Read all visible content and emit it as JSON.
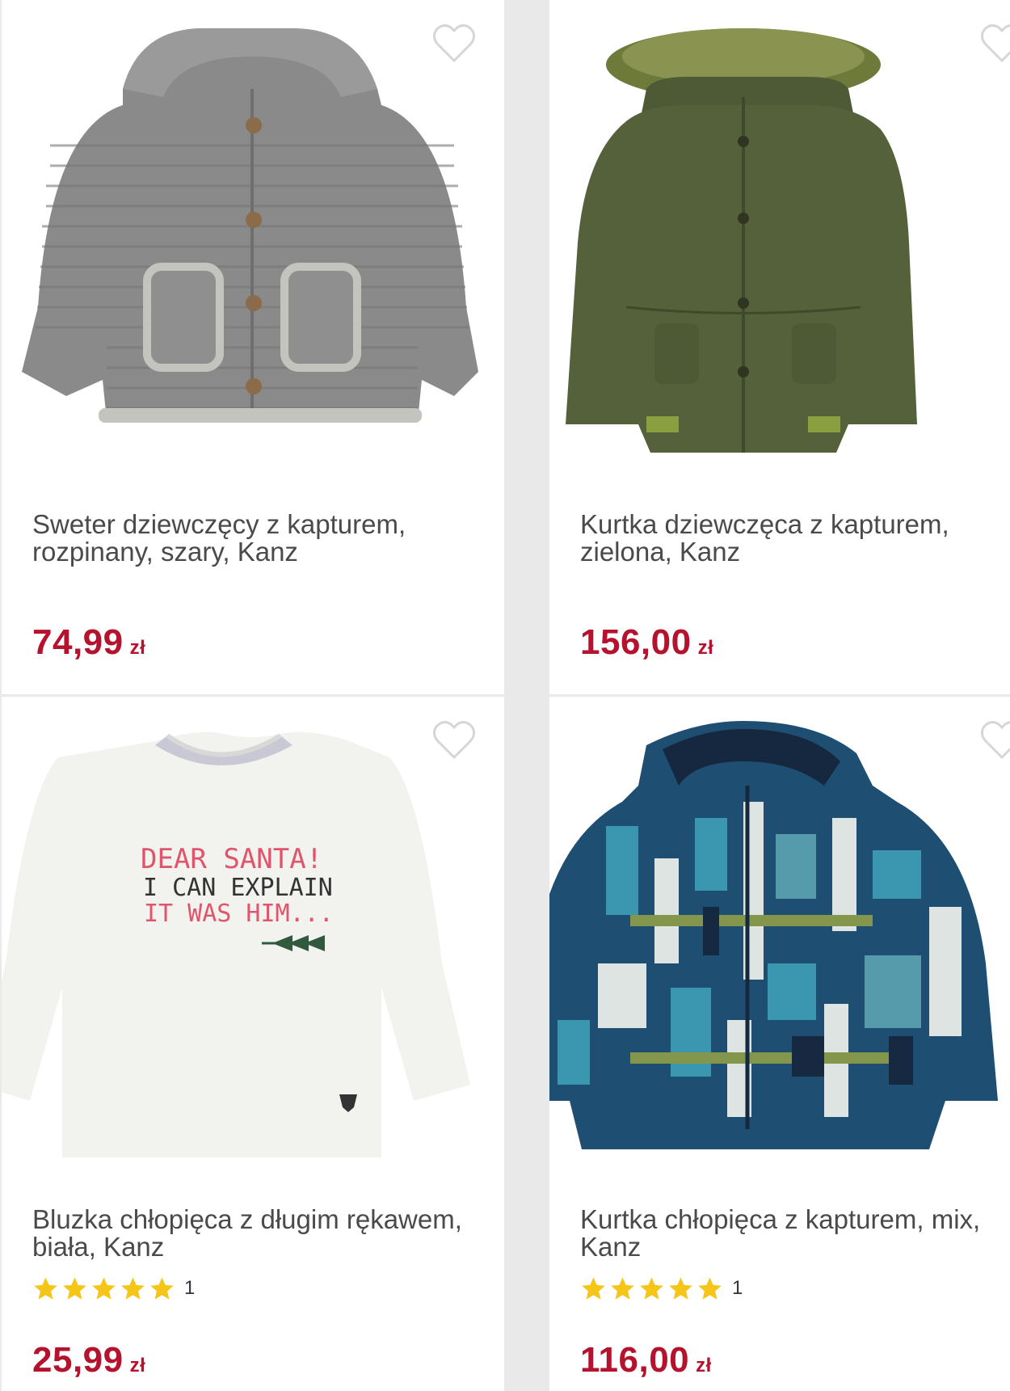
{
  "products": [
    {
      "name": "Sweter dziewczęcy z kapturem, rozpinany, szary, Kanz",
      "price": "74,99",
      "currency": "zł",
      "image": "grey-knit-hooded-cardigan"
    },
    {
      "name": "Kurtka dziewczęca z kapturem, zielona, Kanz",
      "price": "156,00",
      "currency": "zł",
      "image": "green-parka-with-fur-hood"
    },
    {
      "name": "Bluzka chłopięca z długim rękawem, biała, Kanz",
      "price": "25,99",
      "currency": "zł",
      "rating": {
        "stars": 5,
        "count": "1"
      },
      "image": "white-long-sleeve-shirt",
      "print_text": [
        "DEAR SANTA!",
        "I CAN EXPLAIN",
        "IT WAS HIM..."
      ]
    },
    {
      "name": "Kurtka chłopięca z kapturem, mix, Kanz",
      "price": "116,00",
      "currency": "zł",
      "rating": {
        "stars": 5,
        "count": "1"
      },
      "image": "blue-patterned-hooded-jacket"
    }
  ],
  "colors": {
    "price": "#b5122d",
    "star": "#f5c518",
    "heart_outline": "#d6d6d6"
  },
  "icons": {
    "favorite": "heart-outline-icon",
    "rating": "star-icon"
  }
}
